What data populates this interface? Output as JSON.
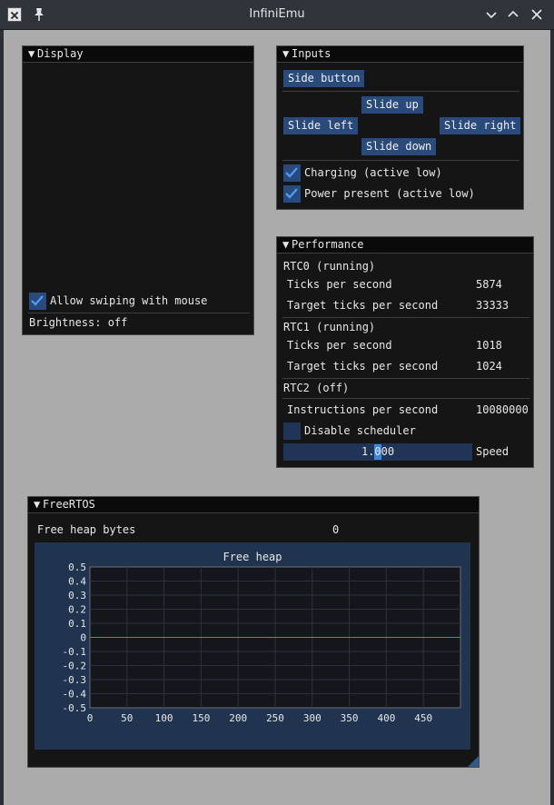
{
  "window": {
    "title": "InfiniEmu"
  },
  "display": {
    "title": "Display",
    "allow_swiping_label": "Allow swiping with mouse",
    "allow_swiping_checked": true,
    "brightness_text": "Brightness: off"
  },
  "inputs": {
    "title": "Inputs",
    "side_button": "Side button",
    "slide_up": "Slide up",
    "slide_left": "Slide left",
    "slide_right": "Slide right",
    "slide_down": "Slide down",
    "charging_label": "Charging (active low)",
    "charging_checked": true,
    "power_label": "Power present (active low)",
    "power_checked": true
  },
  "performance": {
    "title": "Performance",
    "rtc0": {
      "header": "RTC0 (running)",
      "rows": [
        {
          "label": "Ticks per second",
          "value": "5874"
        },
        {
          "label": "Target ticks per second",
          "value": "33333"
        }
      ]
    },
    "rtc1": {
      "header": "RTC1 (running)",
      "rows": [
        {
          "label": "Ticks per second",
          "value": "1018"
        },
        {
          "label": "Target ticks per second",
          "value": "1024"
        }
      ]
    },
    "rtc2": {
      "header": "RTC2 (off)"
    },
    "instructions_label": "Instructions per second",
    "instructions_value": "10080000",
    "disable_scheduler_label": "Disable scheduler",
    "disable_scheduler_checked": false,
    "speed_value_text": "1.000",
    "speed_value": 1.0,
    "speed_label": "Speed"
  },
  "freertos": {
    "title": "FreeRTOS",
    "free_heap_label": "Free heap bytes",
    "free_heap_value": "0"
  },
  "chart_data": {
    "type": "line",
    "title": "Free heap",
    "xlabel": "",
    "ylabel": "",
    "xlim": [
      0,
      500
    ],
    "ylim": [
      -0.5,
      0.5
    ],
    "x_ticks": [
      "0",
      "50",
      "100",
      "150",
      "200",
      "250",
      "300",
      "350",
      "400",
      "450"
    ],
    "y_ticks": [
      "0.5",
      "0.4",
      "0.3",
      "0.2",
      "0.1",
      "0",
      "-0.1",
      "-0.2",
      "-0.3",
      "-0.4",
      "-0.5"
    ],
    "grid": true,
    "series": [
      {
        "x": [
          0,
          500
        ],
        "y": [
          0,
          0
        ]
      }
    ],
    "colors": {
      "line": "#4f7fc4",
      "frame": "#20334f",
      "plot_bg": "#14161b",
      "grid": "#2c323c"
    }
  }
}
